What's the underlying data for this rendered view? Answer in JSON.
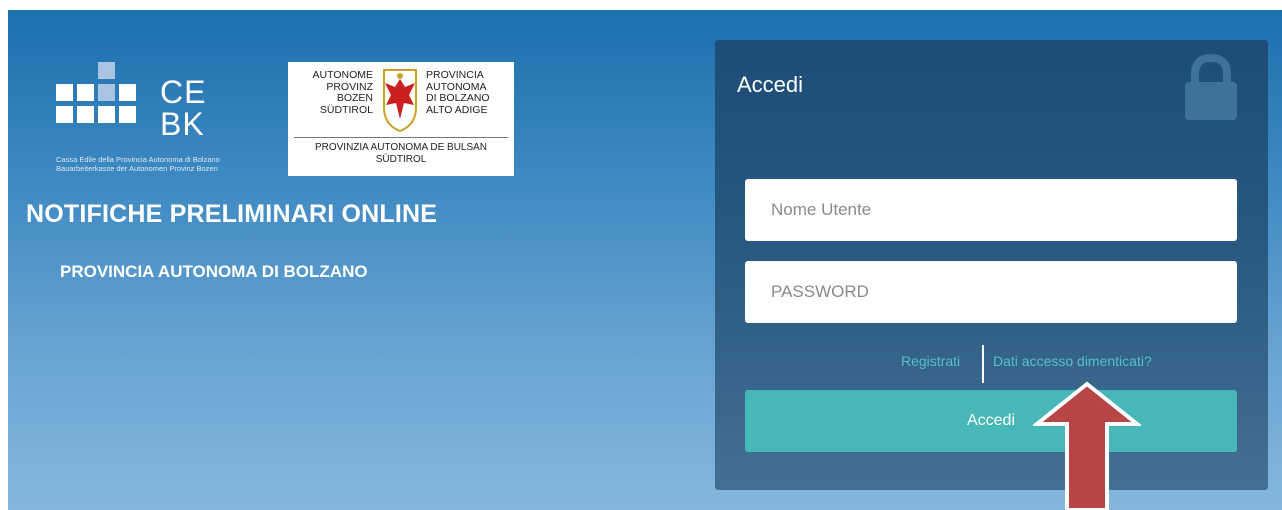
{
  "header": {
    "cebk_logo": {
      "ce": "CE",
      "bk": "BK",
      "tagline_1": "Cassa Edile della Provincia Autonoma di Bolzano",
      "tagline_2": "Bauarbeiterkasse der Autonomen Provinz Bozen"
    },
    "province_logo": {
      "left": [
        "AUTONOME",
        "PROVINZ",
        "BOZEN",
        "SÜDTIROL"
      ],
      "right": [
        "PROVINCIA",
        "AUTONOMA",
        "DI BOLZANO",
        "ALTO ADIGE"
      ],
      "bottom_1": "PROVINZIA AUTONOMA DE BULSAN",
      "bottom_2": "SÜDTIROL"
    },
    "title": "NOTIFICHE PRELIMINARI ONLINE",
    "subtitle": "PROVINCIA AUTONOMA DI BOLZANO"
  },
  "login": {
    "title": "Accedi",
    "icon": "lock-icon",
    "username_placeholder": "Nome Utente",
    "password_placeholder": "PASSWORD",
    "register_link": "Registrati",
    "forgot_link": "Dati accesso dimenticati?",
    "submit_label": "Accedi"
  },
  "colors": {
    "accent": "#47b7b8",
    "link": "#53c0c6",
    "panel": "#26577f",
    "arrow": "#b84545"
  }
}
